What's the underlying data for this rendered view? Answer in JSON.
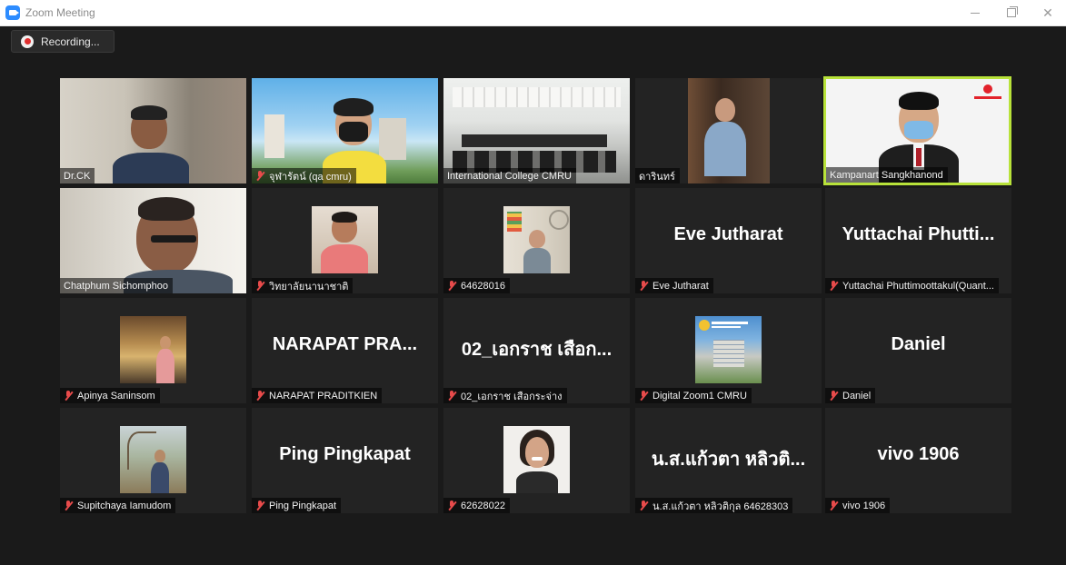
{
  "window": {
    "title": "Zoom Meeting",
    "controls": [
      "minimize-icon",
      "restore-icon",
      "close-icon"
    ]
  },
  "recording": {
    "label": "Recording..."
  },
  "participants": [
    {
      "name": "Dr.CK",
      "muted": false,
      "has_video": true
    },
    {
      "name": "จุฬารัตน์ (qa cmru)",
      "muted": true,
      "has_video": true
    },
    {
      "name": "International College CMRU",
      "muted": false,
      "has_video": true
    },
    {
      "name": "ดารินทร์",
      "muted": false,
      "has_video": true
    },
    {
      "name": "Kampanart Sangkhanond",
      "muted": false,
      "has_video": true,
      "active_speaker": true
    },
    {
      "name": "Chatphum Sichomphoo",
      "muted": false,
      "has_video": true
    },
    {
      "name": "วิทยาลัยนานาชาติ",
      "muted": true,
      "has_video": true
    },
    {
      "name": "64628016",
      "muted": true,
      "has_video": true
    },
    {
      "name": "Eve Jutharat",
      "display_name": "Eve Jutharat",
      "muted": true,
      "has_video": false
    },
    {
      "name": "Yuttachai Phuttimoottakul(Quant...",
      "display_name": "Yuttachai  Phutti...",
      "muted": true,
      "has_video": false
    },
    {
      "name": "Apinya Saninsom",
      "muted": true,
      "has_video": true
    },
    {
      "name": "NARAPAT PRADITKIEN",
      "display_name": "NARAPAT  PRA...",
      "muted": true,
      "has_video": false
    },
    {
      "name": "02_เอกราช เสือกระจ่าง",
      "display_name": "02_เอกราช เสือก...",
      "muted": true,
      "has_video": false
    },
    {
      "name": "Digital Zoom1 CMRU",
      "muted": true,
      "has_video": true
    },
    {
      "name": "Daniel",
      "display_name": "Daniel",
      "muted": true,
      "has_video": false
    },
    {
      "name": "Supitchaya Iamudom",
      "muted": true,
      "has_video": true
    },
    {
      "name": "Ping Pingkapat",
      "display_name": "Ping Pingkapat",
      "muted": true,
      "has_video": false
    },
    {
      "name": "62628022",
      "muted": true,
      "has_video": true
    },
    {
      "name": "น.ส.แก้วตา หลิวติกุล 64628303",
      "display_name": "น.ส.แก้วตา หลิวติ...",
      "muted": true,
      "has_video": false
    },
    {
      "name": "vivo 1906",
      "display_name": "vivo 1906",
      "muted": true,
      "has_video": false
    }
  ],
  "colors": {
    "active_speaker_border": "#b8e23a",
    "muted_icon": "#e84b4b",
    "background": "#1a1a1a"
  }
}
